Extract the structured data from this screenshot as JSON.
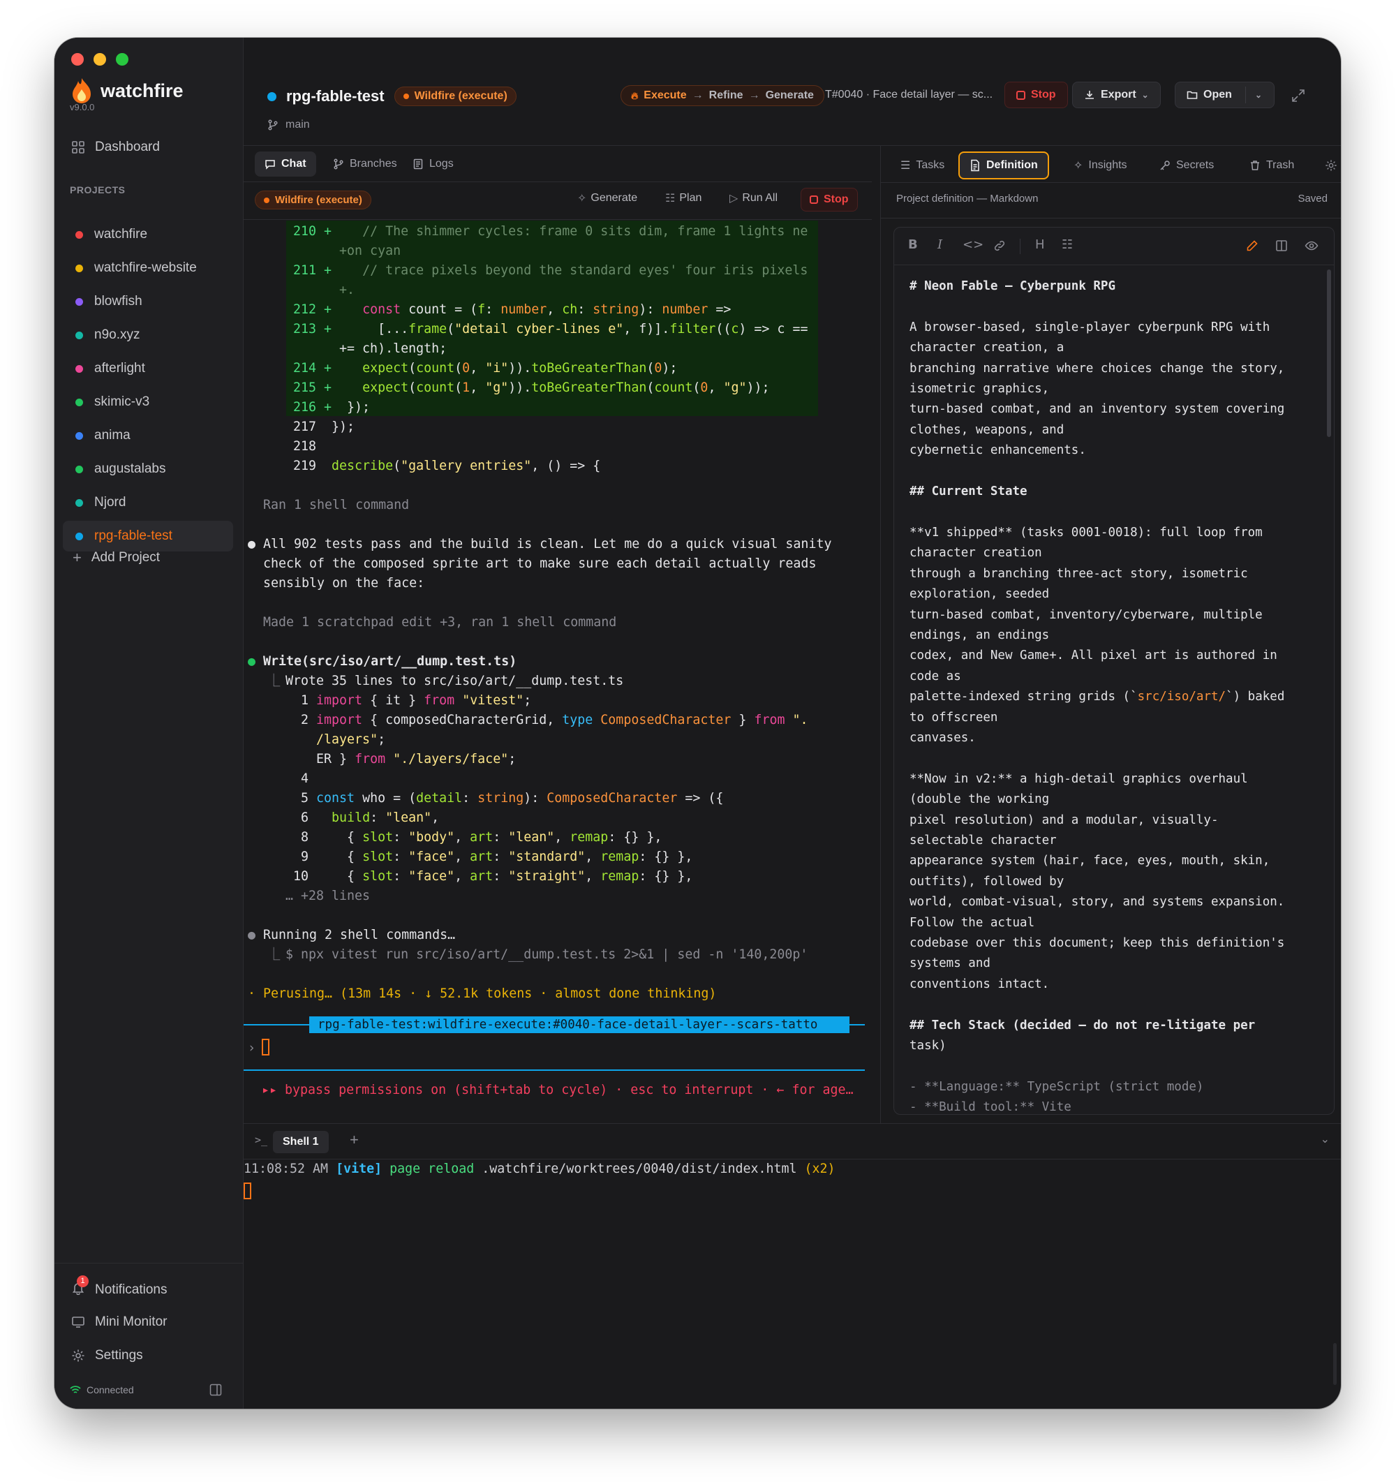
{
  "sidebar": {
    "app_name": "watchfire",
    "version": "v9.0.0",
    "dashboard": "Dashboard",
    "projects_label": "PROJECTS",
    "projects": [
      {
        "name": "watchfire",
        "color": "#ef4444"
      },
      {
        "name": "watchfire-website",
        "color": "#eab308"
      },
      {
        "name": "blowfish",
        "color": "#8b5cf6"
      },
      {
        "name": "n9o.xyz",
        "color": "#14b8a6"
      },
      {
        "name": "afterlight",
        "color": "#ec4899"
      },
      {
        "name": "skimic-v3",
        "color": "#22c55e"
      },
      {
        "name": "anima",
        "color": "#3b82f6"
      },
      {
        "name": "augustalabs",
        "color": "#22c55e"
      },
      {
        "name": "Njord",
        "color": "#14b8a6"
      },
      {
        "name": "rpg-fable-test",
        "color": "#0ea5e9",
        "active": true
      }
    ],
    "add_project": "Add Project",
    "notifications": "Notifications",
    "notifications_count": "1",
    "mini_monitor": "Mini Monitor",
    "settings": "Settings",
    "connection": "Connected"
  },
  "header": {
    "project": "rpg-fable-test",
    "mode_badge": "Wildfire (execute)",
    "branch": "main",
    "pipeline": [
      "Execute",
      "Refine",
      "Generate"
    ],
    "task_ref": "T#0040 · Face detail layer — sc...",
    "stop": "Stop",
    "export": "Export",
    "open": "Open"
  },
  "left_tabs": [
    "Chat",
    "Branches",
    "Logs"
  ],
  "left_toolbar": {
    "mode": "Wildfire (execute)",
    "generate": "Generate",
    "plan": "Plan",
    "run_all": "Run All",
    "stop": "Stop"
  },
  "chat": {
    "ran_shell": "Ran 1 shell command",
    "msg1": [
      "All 902 tests pass and the build is clean. Let me do a quick visual sanity",
      "check of the composed sprite art to make sure each detail actually reads",
      "sensibly on the face:"
    ],
    "scratch": "Made 1 scratchpad edit +3, ran 1 shell command",
    "write_cmd": "Write(src/iso/art/__dump.test.ts)",
    "wrote": "Wrote 35 lines to src/iso/art/__dump.test.ts",
    "more_lines": "… +28 lines",
    "running": "Running 2 shell commands…",
    "shell_cmd": "$ npx vitest run src/iso/art/__dump.test.ts 2>&1 | sed -n '140,200p'",
    "perusing": "Perusing… (13m 14s · ↓ 52.1k tokens · almost done thinking)",
    "session_tag": "rpg-fable-test:wildfire-execute:#0040-face-detail-layer--scars-tatto",
    "bypass": "bypass permissions on (shift+tab to cycle) · esc to interrupt · ← for age…"
  },
  "right_tabs": [
    "Tasks",
    "Definition",
    "Insights",
    "Secrets",
    "Trash"
  ],
  "definition": {
    "heading": "Project definition — Markdown",
    "saved": "Saved",
    "content": "# Neon Fable — Cyberpunk RPG\n\nA browser-based, single-player cyberpunk RPG with\ncharacter creation, a\nbranching narrative where choices change the story,\nisometric graphics,\nturn-based combat, and an inventory system covering\nclothes, weapons, and\ncybernetic enhancements.\n\n## Current State\n\n**v1 shipped** (tasks 0001-0018): full loop from\ncharacter creation\nthrough a branching three-act story, isometric\nexploration, seeded\nturn-based combat, inventory/cyberware, multiple\nendings, an endings\ncodex, and New Game+. All pixel art is authored in\ncode as\npalette-indexed string grids (`src/iso/art/`) baked\nto offscreen\ncanvases.\n\n**Now in v2:** a high-detail graphics overhaul\n(double the working\npixel resolution) and a modular, visually-\nselectable character\nappearance system (hair, face, eyes, mouth, skin,\noutfits), followed by\nworld, combat-visual, story, and systems expansion.\nFollow the actual\ncodebase over this document; keep this definition's\nsystems and\nconventions intact.\n\n## Tech Stack (decided — do not re-litigate per\ntask)\n\n- **Language:** TypeScript (strict mode)\n- **Build tool:** Vite"
  },
  "shell": {
    "tab": "Shell 1",
    "time": "11:08:52 AM",
    "vite": "[vite]",
    "reload": "page reload",
    "path": ".watchfire/worktrees/0040/dist/index.html",
    "count": "(x2)"
  }
}
